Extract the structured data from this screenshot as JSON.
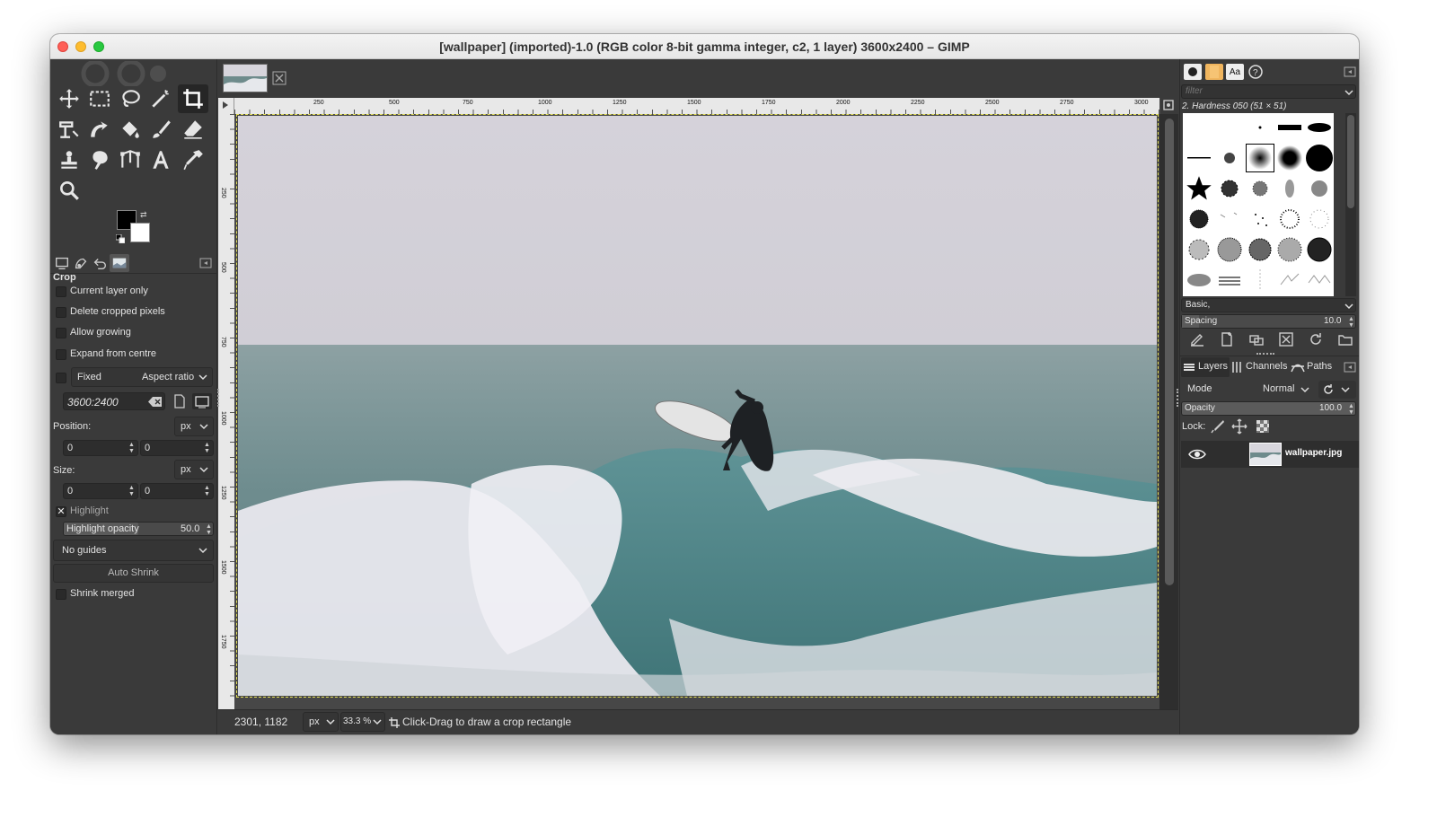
{
  "window": {
    "title": "[wallpaper] (imported)-1.0 (RGB color 8-bit gamma integer, c2, 1 layer) 3600x2400 – GIMP"
  },
  "toolbox": {
    "tools": [
      "move-tool-icon",
      "rect-select-tool-icon",
      "lasso-tool-icon",
      "fuzzy-select-tool-icon",
      "crop-tool-icon",
      "unified-transform-tool-icon",
      "warp-transform-tool-icon",
      "bucket-fill-tool-icon",
      "paintbrush-tool-icon",
      "eraser-tool-icon",
      "clone-tool-icon",
      "smudge-tool-icon",
      "paths-tool-icon",
      "text-tool-icon",
      "color-picker-tool-icon",
      "zoom-tool-icon"
    ]
  },
  "tool_options": {
    "title": "Crop",
    "current_layer_only": "Current layer only",
    "delete_cropped": "Delete cropped pixels",
    "allow_growing": "Allow growing",
    "expand_from_centre": "Expand from centre",
    "fixed_label": "Fixed",
    "fixed_mode": "Aspect ratio",
    "ratio_value": "3600:2400",
    "position_label": "Position:",
    "position_unit": "px",
    "position_x": "0",
    "position_y": "0",
    "size_label": "Size:",
    "size_unit": "px",
    "size_w": "0",
    "size_h": "0",
    "highlight": "Highlight",
    "highlight_opacity_label": "Highlight opacity",
    "highlight_opacity_value": "50.0",
    "guides": "No guides",
    "auto_shrink": "Auto Shrink",
    "shrink_merged": "Shrink merged"
  },
  "ruler": {
    "labels": [
      "250",
      "500",
      "750",
      "1000",
      "1250",
      "1500",
      "1750",
      "2000",
      "2250",
      "2500",
      "2750",
      "3000"
    ],
    "v_labels": [
      "250",
      "500",
      "750",
      "1000",
      "1250",
      "1500",
      "1750"
    ]
  },
  "statusbar": {
    "coords": "2301, 1182",
    "unit": "px",
    "zoom": "33.3 %",
    "message": "Click-Drag to draw a crop rectangle"
  },
  "brushes": {
    "filter_placeholder": "filter",
    "selected_brush": "2. Hardness 050 (51 × 51)",
    "preset": "Basic,",
    "spacing_label": "Spacing",
    "spacing_value": "10.0"
  },
  "layers": {
    "tabs": [
      "Layers",
      "Channels",
      "Paths"
    ],
    "mode_label": "Mode",
    "mode_value": "Normal",
    "opacity_label": "Opacity",
    "opacity_value": "100.0",
    "lock_label": "Lock:",
    "items": [
      {
        "name": "wallpaper.jpg"
      }
    ]
  },
  "colors": {
    "accent": "#f0b55e",
    "bg": "#3c3c3c",
    "panel": "#3a3a3a"
  }
}
